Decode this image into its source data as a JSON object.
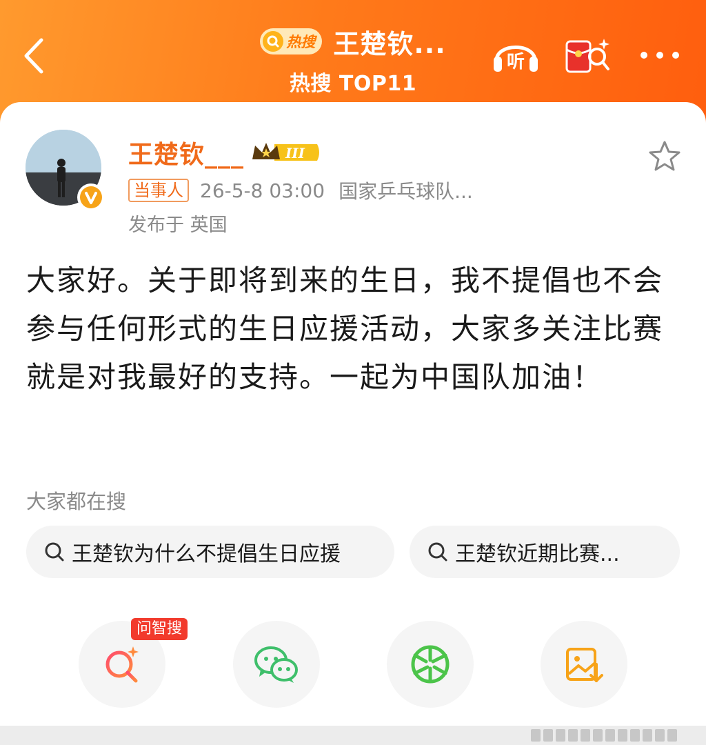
{
  "header": {
    "hot_label": "热搜",
    "title": "王楚钦...",
    "subtitle": "热搜 TOP11",
    "icons": [
      "back-icon",
      "listen-icon",
      "red-packet-search-icon",
      "more-icon"
    ],
    "listen_glyph": "听"
  },
  "post": {
    "username": "王楚钦___",
    "vip_level": "III",
    "role_tag": "当事人",
    "time": "26-5-8 03:00",
    "source": "国家乒乓球队...",
    "location": "发布于 英国",
    "text": "大家好。关于即将到来的生日，我不提倡也不会参与任何形式的生日应援活动，大家多关注比赛就是对我最好的支持。一起为中国队加油！"
  },
  "related": {
    "label": "大家都在搜",
    "searches": [
      "王楚钦为什么不提倡生日应援",
      "王楚钦近期比赛..."
    ]
  },
  "actions": {
    "ai_tag": "问智搜",
    "icons": [
      "ai-search-icon",
      "wechat-icon",
      "moments-icon",
      "save-image-icon"
    ]
  },
  "colors": {
    "header_start": "#ff9a2e",
    "header_end": "#ff5e0e",
    "username": "#f06a1a",
    "tag_red": "#f23a2c",
    "wechat_green": "#3fbf6b"
  }
}
